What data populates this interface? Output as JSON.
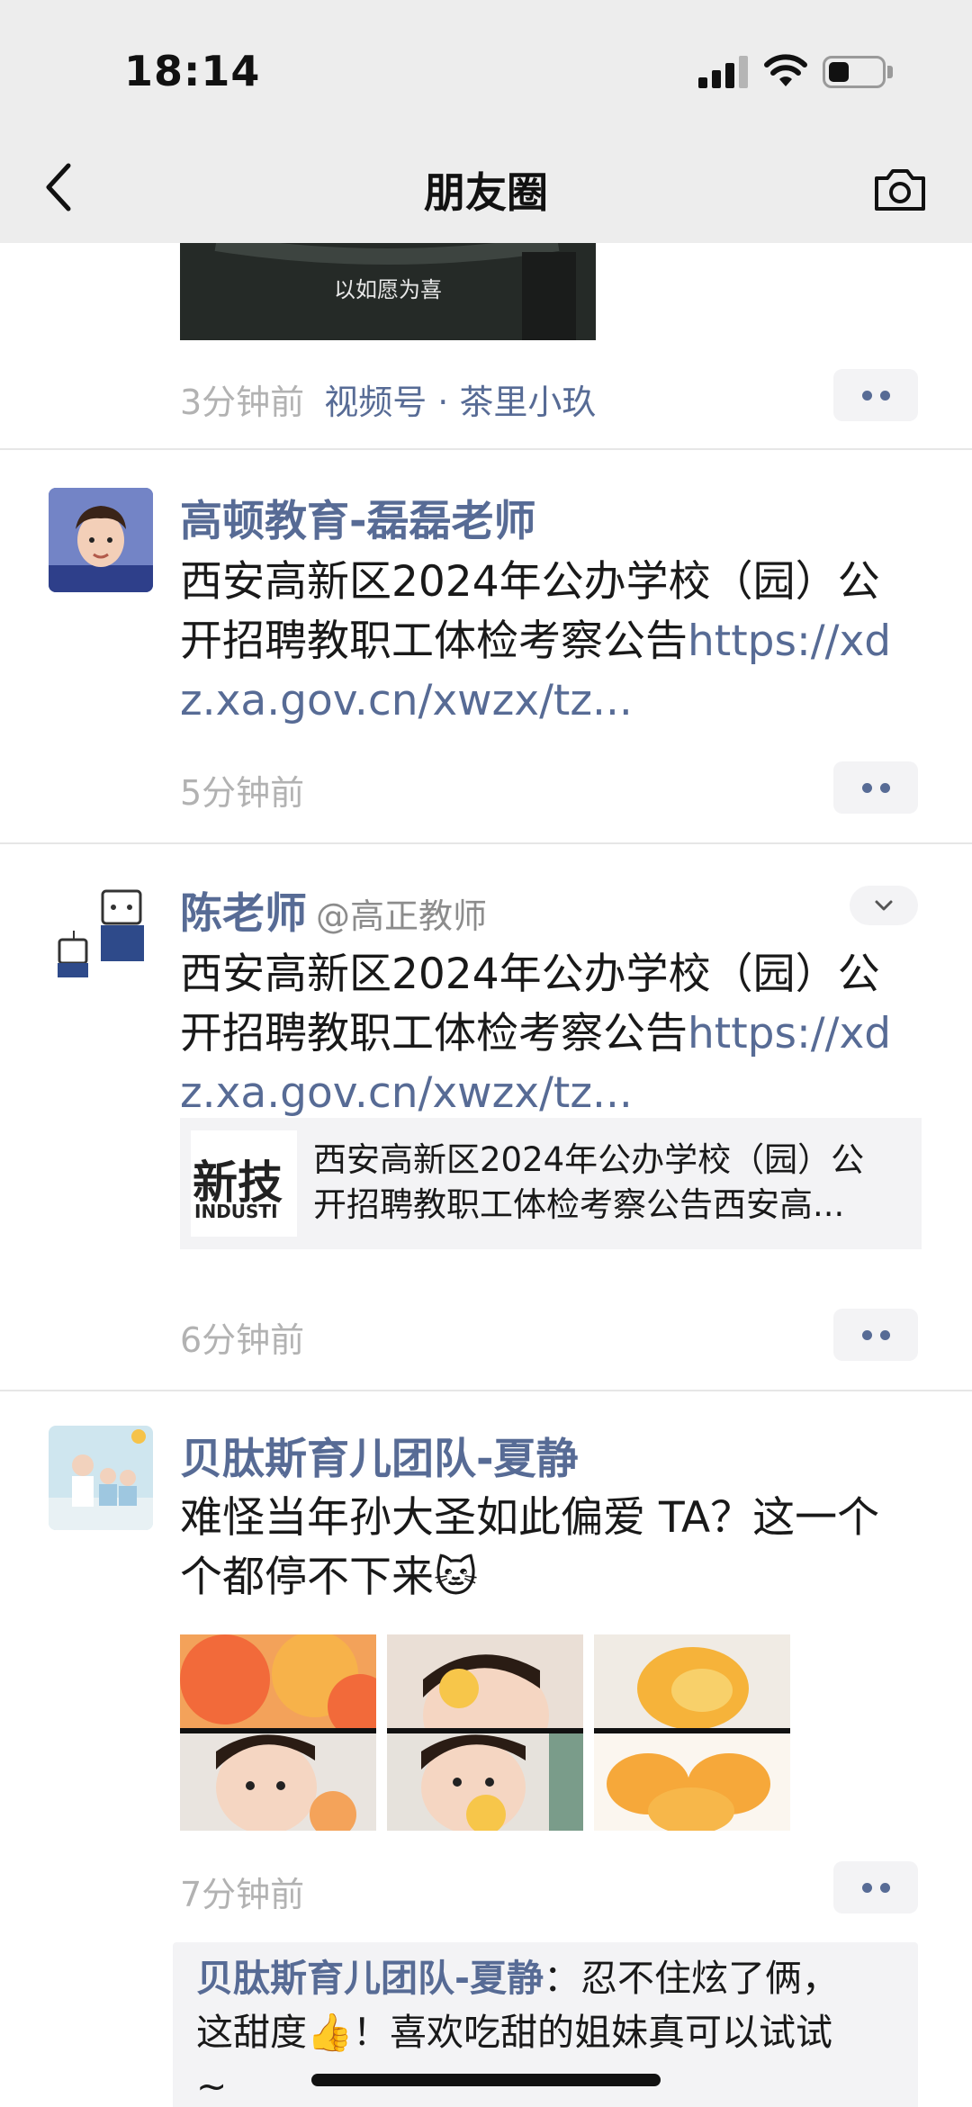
{
  "status_bar": {
    "time": "18:14"
  },
  "nav": {
    "title": "朋友圈",
    "back_icon": "chevron-left-icon",
    "camera_icon": "camera-icon"
  },
  "posts": [
    {
      "video_caption": "以如愿为喜",
      "time": "3分钟前",
      "source": "视频号 · 茶里小玖"
    },
    {
      "author": "高顿教育-磊磊老师",
      "text_lines": [
        "西安高新区2024年公办学校（园）公",
        "开招聘教职工体检考察公告"
      ],
      "link_line1": "https://xd",
      "link_line2": "z.xa.gov.cn/xwzx/tz...",
      "time": "5分钟前"
    },
    {
      "author": "陈老师",
      "handle": "@高正教师",
      "text_lines": [
        "西安高新区2024年公办学校（园）公",
        "开招聘教职工体检考察公告"
      ],
      "link_line1": "https://xd",
      "link_line2": "z.xa.gov.cn/xwzx/tz...",
      "card": {
        "thumb_text_big": "新技",
        "thumb_text_small": "INDUSTI",
        "line1": "西安高新区2024年公办学校（园）公",
        "line2": "开招聘教职工体检考察公告西安高..."
      },
      "time": "6分钟前"
    },
    {
      "author": "贝肽斯育儿团队-夏静",
      "text_line1": "难怪当年孙大圣如此偏爱 TA？这一个",
      "text_line2": "个都停不下来🐱",
      "time": "7分钟前",
      "comment": {
        "author": "贝肽斯育儿团队-夏静",
        "line1": "：忍不住炫了俩，",
        "line2": "这甜度👍！喜欢吃甜的姐妹真可以试试",
        "line3": "~"
      }
    }
  ]
}
